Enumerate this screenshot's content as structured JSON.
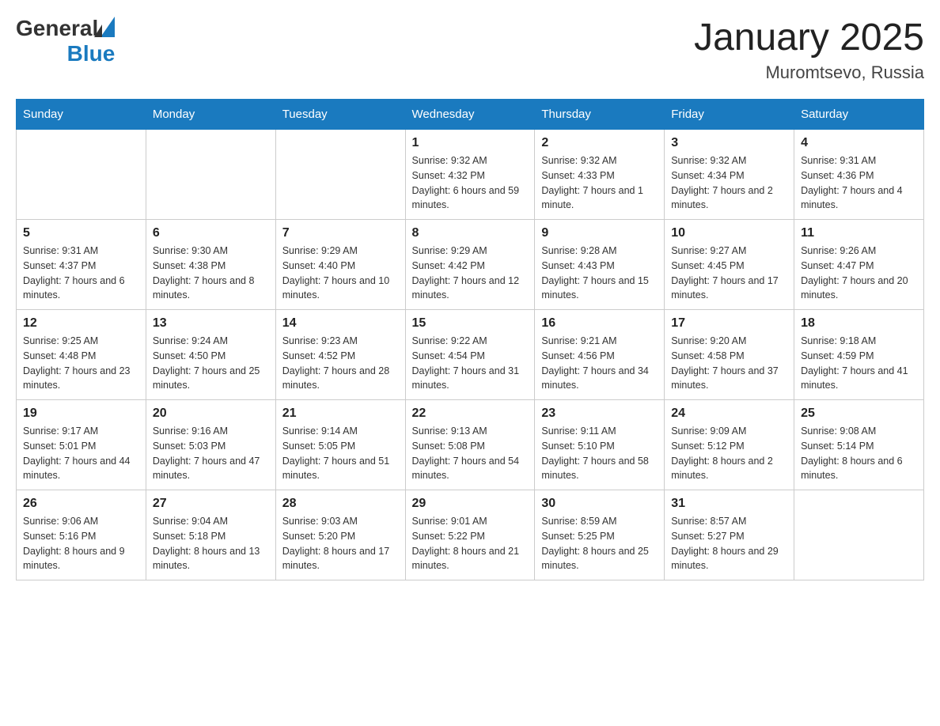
{
  "header": {
    "logo": {
      "general": "General",
      "blue": "Blue"
    },
    "title": "January 2025",
    "location": "Muromtsevo, Russia"
  },
  "calendar": {
    "days_of_week": [
      "Sunday",
      "Monday",
      "Tuesday",
      "Wednesday",
      "Thursday",
      "Friday",
      "Saturday"
    ],
    "weeks": [
      [
        {
          "day": "",
          "sunrise": "",
          "sunset": "",
          "daylight": ""
        },
        {
          "day": "",
          "sunrise": "",
          "sunset": "",
          "daylight": ""
        },
        {
          "day": "",
          "sunrise": "",
          "sunset": "",
          "daylight": ""
        },
        {
          "day": "1",
          "sunrise": "Sunrise: 9:32 AM",
          "sunset": "Sunset: 4:32 PM",
          "daylight": "Daylight: 6 hours and 59 minutes."
        },
        {
          "day": "2",
          "sunrise": "Sunrise: 9:32 AM",
          "sunset": "Sunset: 4:33 PM",
          "daylight": "Daylight: 7 hours and 1 minute."
        },
        {
          "day": "3",
          "sunrise": "Sunrise: 9:32 AM",
          "sunset": "Sunset: 4:34 PM",
          "daylight": "Daylight: 7 hours and 2 minutes."
        },
        {
          "day": "4",
          "sunrise": "Sunrise: 9:31 AM",
          "sunset": "Sunset: 4:36 PM",
          "daylight": "Daylight: 7 hours and 4 minutes."
        }
      ],
      [
        {
          "day": "5",
          "sunrise": "Sunrise: 9:31 AM",
          "sunset": "Sunset: 4:37 PM",
          "daylight": "Daylight: 7 hours and 6 minutes."
        },
        {
          "day": "6",
          "sunrise": "Sunrise: 9:30 AM",
          "sunset": "Sunset: 4:38 PM",
          "daylight": "Daylight: 7 hours and 8 minutes."
        },
        {
          "day": "7",
          "sunrise": "Sunrise: 9:29 AM",
          "sunset": "Sunset: 4:40 PM",
          "daylight": "Daylight: 7 hours and 10 minutes."
        },
        {
          "day": "8",
          "sunrise": "Sunrise: 9:29 AM",
          "sunset": "Sunset: 4:42 PM",
          "daylight": "Daylight: 7 hours and 12 minutes."
        },
        {
          "day": "9",
          "sunrise": "Sunrise: 9:28 AM",
          "sunset": "Sunset: 4:43 PM",
          "daylight": "Daylight: 7 hours and 15 minutes."
        },
        {
          "day": "10",
          "sunrise": "Sunrise: 9:27 AM",
          "sunset": "Sunset: 4:45 PM",
          "daylight": "Daylight: 7 hours and 17 minutes."
        },
        {
          "day": "11",
          "sunrise": "Sunrise: 9:26 AM",
          "sunset": "Sunset: 4:47 PM",
          "daylight": "Daylight: 7 hours and 20 minutes."
        }
      ],
      [
        {
          "day": "12",
          "sunrise": "Sunrise: 9:25 AM",
          "sunset": "Sunset: 4:48 PM",
          "daylight": "Daylight: 7 hours and 23 minutes."
        },
        {
          "day": "13",
          "sunrise": "Sunrise: 9:24 AM",
          "sunset": "Sunset: 4:50 PM",
          "daylight": "Daylight: 7 hours and 25 minutes."
        },
        {
          "day": "14",
          "sunrise": "Sunrise: 9:23 AM",
          "sunset": "Sunset: 4:52 PM",
          "daylight": "Daylight: 7 hours and 28 minutes."
        },
        {
          "day": "15",
          "sunrise": "Sunrise: 9:22 AM",
          "sunset": "Sunset: 4:54 PM",
          "daylight": "Daylight: 7 hours and 31 minutes."
        },
        {
          "day": "16",
          "sunrise": "Sunrise: 9:21 AM",
          "sunset": "Sunset: 4:56 PM",
          "daylight": "Daylight: 7 hours and 34 minutes."
        },
        {
          "day": "17",
          "sunrise": "Sunrise: 9:20 AM",
          "sunset": "Sunset: 4:58 PM",
          "daylight": "Daylight: 7 hours and 37 minutes."
        },
        {
          "day": "18",
          "sunrise": "Sunrise: 9:18 AM",
          "sunset": "Sunset: 4:59 PM",
          "daylight": "Daylight: 7 hours and 41 minutes."
        }
      ],
      [
        {
          "day": "19",
          "sunrise": "Sunrise: 9:17 AM",
          "sunset": "Sunset: 5:01 PM",
          "daylight": "Daylight: 7 hours and 44 minutes."
        },
        {
          "day": "20",
          "sunrise": "Sunrise: 9:16 AM",
          "sunset": "Sunset: 5:03 PM",
          "daylight": "Daylight: 7 hours and 47 minutes."
        },
        {
          "day": "21",
          "sunrise": "Sunrise: 9:14 AM",
          "sunset": "Sunset: 5:05 PM",
          "daylight": "Daylight: 7 hours and 51 minutes."
        },
        {
          "day": "22",
          "sunrise": "Sunrise: 9:13 AM",
          "sunset": "Sunset: 5:08 PM",
          "daylight": "Daylight: 7 hours and 54 minutes."
        },
        {
          "day": "23",
          "sunrise": "Sunrise: 9:11 AM",
          "sunset": "Sunset: 5:10 PM",
          "daylight": "Daylight: 7 hours and 58 minutes."
        },
        {
          "day": "24",
          "sunrise": "Sunrise: 9:09 AM",
          "sunset": "Sunset: 5:12 PM",
          "daylight": "Daylight: 8 hours and 2 minutes."
        },
        {
          "day": "25",
          "sunrise": "Sunrise: 9:08 AM",
          "sunset": "Sunset: 5:14 PM",
          "daylight": "Daylight: 8 hours and 6 minutes."
        }
      ],
      [
        {
          "day": "26",
          "sunrise": "Sunrise: 9:06 AM",
          "sunset": "Sunset: 5:16 PM",
          "daylight": "Daylight: 8 hours and 9 minutes."
        },
        {
          "day": "27",
          "sunrise": "Sunrise: 9:04 AM",
          "sunset": "Sunset: 5:18 PM",
          "daylight": "Daylight: 8 hours and 13 minutes."
        },
        {
          "day": "28",
          "sunrise": "Sunrise: 9:03 AM",
          "sunset": "Sunset: 5:20 PM",
          "daylight": "Daylight: 8 hours and 17 minutes."
        },
        {
          "day": "29",
          "sunrise": "Sunrise: 9:01 AM",
          "sunset": "Sunset: 5:22 PM",
          "daylight": "Daylight: 8 hours and 21 minutes."
        },
        {
          "day": "30",
          "sunrise": "Sunrise: 8:59 AM",
          "sunset": "Sunset: 5:25 PM",
          "daylight": "Daylight: 8 hours and 25 minutes."
        },
        {
          "day": "31",
          "sunrise": "Sunrise: 8:57 AM",
          "sunset": "Sunset: 5:27 PM",
          "daylight": "Daylight: 8 hours and 29 minutes."
        },
        {
          "day": "",
          "sunrise": "",
          "sunset": "",
          "daylight": ""
        }
      ]
    ]
  }
}
